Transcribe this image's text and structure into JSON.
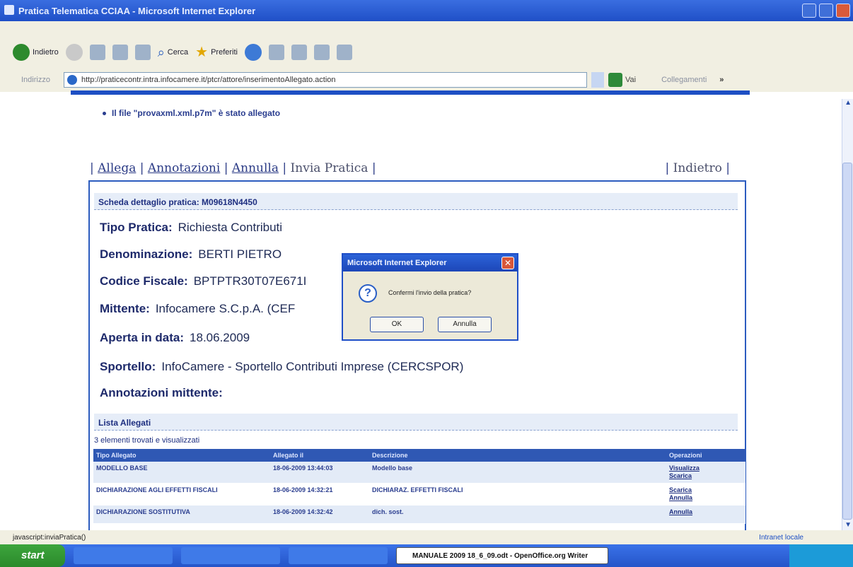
{
  "window": {
    "title": "Pratica Telematica CCIAA - Microsoft Internet Explorer"
  },
  "toolbar": {
    "back_label": "Indietro",
    "search_label": "Cerca",
    "favorites_label": "Preferiti"
  },
  "addressbar": {
    "label": "Indirizzo",
    "url": "http://praticecontr.intra.infocamere.it/ptcr/attore/inserimentoAllegato.action",
    "go_label": "Vai",
    "links_label": "Collegamenti",
    "more": "»"
  },
  "page": {
    "notice": "Il file \"provaxml.xml.p7m\" è stato allegato",
    "nav": {
      "allega": "Allega",
      "annotazioni": "Annotazioni",
      "annulla": "Annulla",
      "invia": "Invia Pratica",
      "indietro": "Indietro",
      "sep": "|"
    },
    "panel_title": "Scheda dettaglio pratica: M09618N4450",
    "fields": [
      {
        "label": "Tipo Pratica:",
        "value": "Richiesta Contributi"
      },
      {
        "label": "Denominazione:",
        "value": "BERTI PIETRO"
      },
      {
        "label": "Codice Fiscale:",
        "value": "BPTPTR30T07E671I"
      },
      {
        "label": "Mittente:",
        "value": "Infocamere S.C.p.A. (CEF"
      },
      {
        "label": "Aperta in data:",
        "value": "18.06.2009"
      },
      {
        "label": "Sportello:",
        "value": "InfoCamere - Sportello Contributi Imprese (CERCSPOR)"
      },
      {
        "label": "Annotazioni mittente:",
        "value": ""
      }
    ],
    "list_title": "Lista Allegati",
    "list_count": "3 elementi trovati e visualizzati",
    "table": {
      "headers": [
        "Tipo Allegato",
        "Allegato il",
        "Descrizione",
        "Operazioni"
      ],
      "rows": [
        {
          "tipo": "MODELLO BASE",
          "data": "18-06-2009 13:44:03",
          "descr": "Modello base",
          "ops": [
            "Visualizza",
            "Scarica"
          ]
        },
        {
          "tipo": "DICHIARAZIONE AGLI EFFETTI FISCALI",
          "data": "18-06-2009 14:32:21",
          "descr": "DICHIARAZ. EFFETTI FISCALI",
          "ops": [
            "Scarica",
            "Annulla"
          ]
        },
        {
          "tipo": "DICHIARAZIONE SOSTITUTIVA",
          "data": "18-06-2009 14:32:42",
          "descr": "dich. sost.",
          "ops": [
            "Annulla"
          ]
        }
      ]
    }
  },
  "dialog": {
    "title": "Microsoft Internet Explorer",
    "message": "Confermi l'invio della pratica?",
    "ok_label": "OK",
    "cancel_label": "Annulla",
    "icon": "?"
  },
  "statusbar": {
    "text": "javascript:inviaPratica()",
    "zone": "Intranet locale"
  },
  "taskbar": {
    "start_label": "start",
    "active_task": "MANUALE 2009 18_6_09.odt - OpenOffice.org Writer"
  }
}
